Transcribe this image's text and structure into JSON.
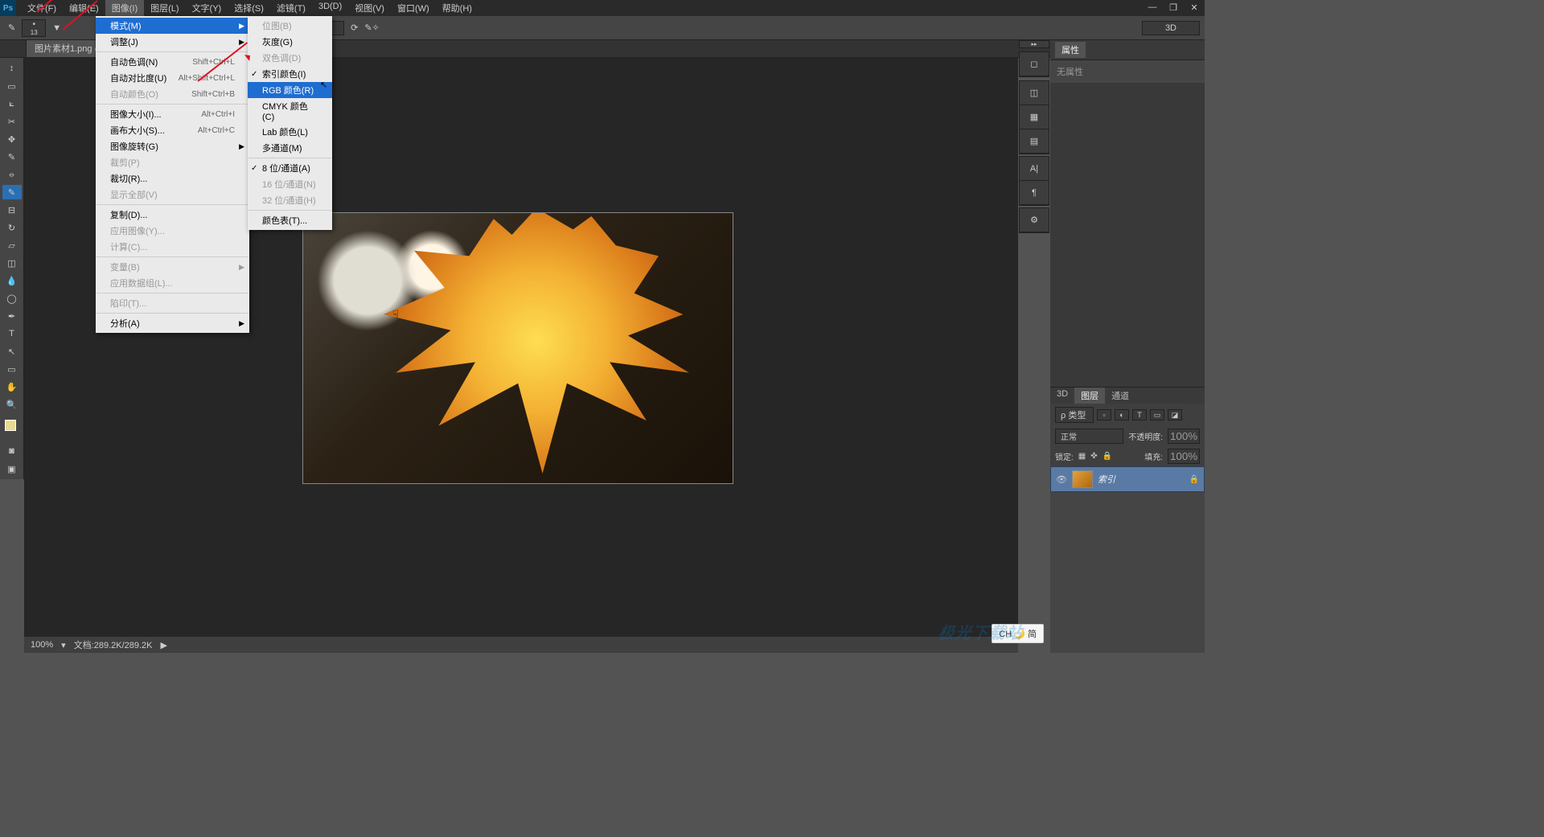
{
  "app": {
    "logo": "Ps"
  },
  "menubar": [
    "文件(F)",
    "编辑(E)",
    "图像(I)",
    "图层(L)",
    "文字(Y)",
    "选择(S)",
    "滤镜(T)",
    "3D(D)",
    "视图(V)",
    "窗口(W)",
    "帮助(H)"
  ],
  "menubar_active_index": 2,
  "options": {
    "brush_size": "13",
    "zoom": "100%",
    "right_mode": "3D"
  },
  "doctab": "图片素材1.png @ ...",
  "image_menu": [
    {
      "label": "模式(M)",
      "shortcut": "",
      "submenu": true,
      "hl": true
    },
    {
      "label": "调整(J)",
      "shortcut": "",
      "submenu": true
    },
    {
      "sep": true
    },
    {
      "label": "自动色调(N)",
      "shortcut": "Shift+Ctrl+L"
    },
    {
      "label": "自动对比度(U)",
      "shortcut": "Alt+Shift+Ctrl+L"
    },
    {
      "label": "自动颜色(O)",
      "shortcut": "Shift+Ctrl+B",
      "disabled": true
    },
    {
      "sep": true
    },
    {
      "label": "图像大小(I)...",
      "shortcut": "Alt+Ctrl+I"
    },
    {
      "label": "画布大小(S)...",
      "shortcut": "Alt+Ctrl+C"
    },
    {
      "label": "图像旋转(G)",
      "shortcut": "",
      "submenu": true
    },
    {
      "label": "裁剪(P)",
      "shortcut": "",
      "disabled": true
    },
    {
      "label": "裁切(R)...",
      "shortcut": ""
    },
    {
      "label": "显示全部(V)",
      "shortcut": "",
      "disabled": true
    },
    {
      "sep": true
    },
    {
      "label": "复制(D)...",
      "shortcut": ""
    },
    {
      "label": "应用图像(Y)...",
      "shortcut": "",
      "disabled": true
    },
    {
      "label": "计算(C)...",
      "shortcut": "",
      "disabled": true
    },
    {
      "sep": true
    },
    {
      "label": "变量(B)",
      "shortcut": "",
      "submenu": true,
      "disabled": true
    },
    {
      "label": "应用数据组(L)...",
      "shortcut": "",
      "disabled": true
    },
    {
      "sep": true
    },
    {
      "label": "陷印(T)...",
      "shortcut": "",
      "disabled": true
    },
    {
      "sep": true
    },
    {
      "label": "分析(A)",
      "shortcut": "",
      "submenu": true
    }
  ],
  "mode_submenu": [
    {
      "label": "位图(B)",
      "disabled": true
    },
    {
      "label": "灰度(G)"
    },
    {
      "label": "双色调(D)",
      "disabled": true
    },
    {
      "label": "索引颜色(I)",
      "checked": true
    },
    {
      "label": "RGB 颜色(R)",
      "hl": true
    },
    {
      "label": "CMYK 颜色(C)"
    },
    {
      "label": "Lab 颜色(L)"
    },
    {
      "label": "多通道(M)"
    },
    {
      "sep": true
    },
    {
      "label": "8 位/通道(A)",
      "checked": true
    },
    {
      "label": "16 位/通道(N)",
      "disabled": true
    },
    {
      "label": "32 位/通道(H)",
      "disabled": true
    },
    {
      "sep": true
    },
    {
      "label": "颜色表(T)..."
    }
  ],
  "properties_panel": {
    "tab": "属性",
    "body": "无属性"
  },
  "layers": {
    "tabs": [
      "3D",
      "图层",
      "通道"
    ],
    "active_tab": 1,
    "filter_label": "ρ 类型",
    "mode": "正常",
    "opacity_label": "不透明度:",
    "opacity": "100%",
    "lock_label": "锁定:",
    "fill_label": "填充:",
    "fill": "100%",
    "layer_name": "索引"
  },
  "status": {
    "zoom": "100%",
    "doc_info": "文档:289.2K/289.2K"
  },
  "ime": "CH 🌙 简",
  "watermark": "极光下载站"
}
